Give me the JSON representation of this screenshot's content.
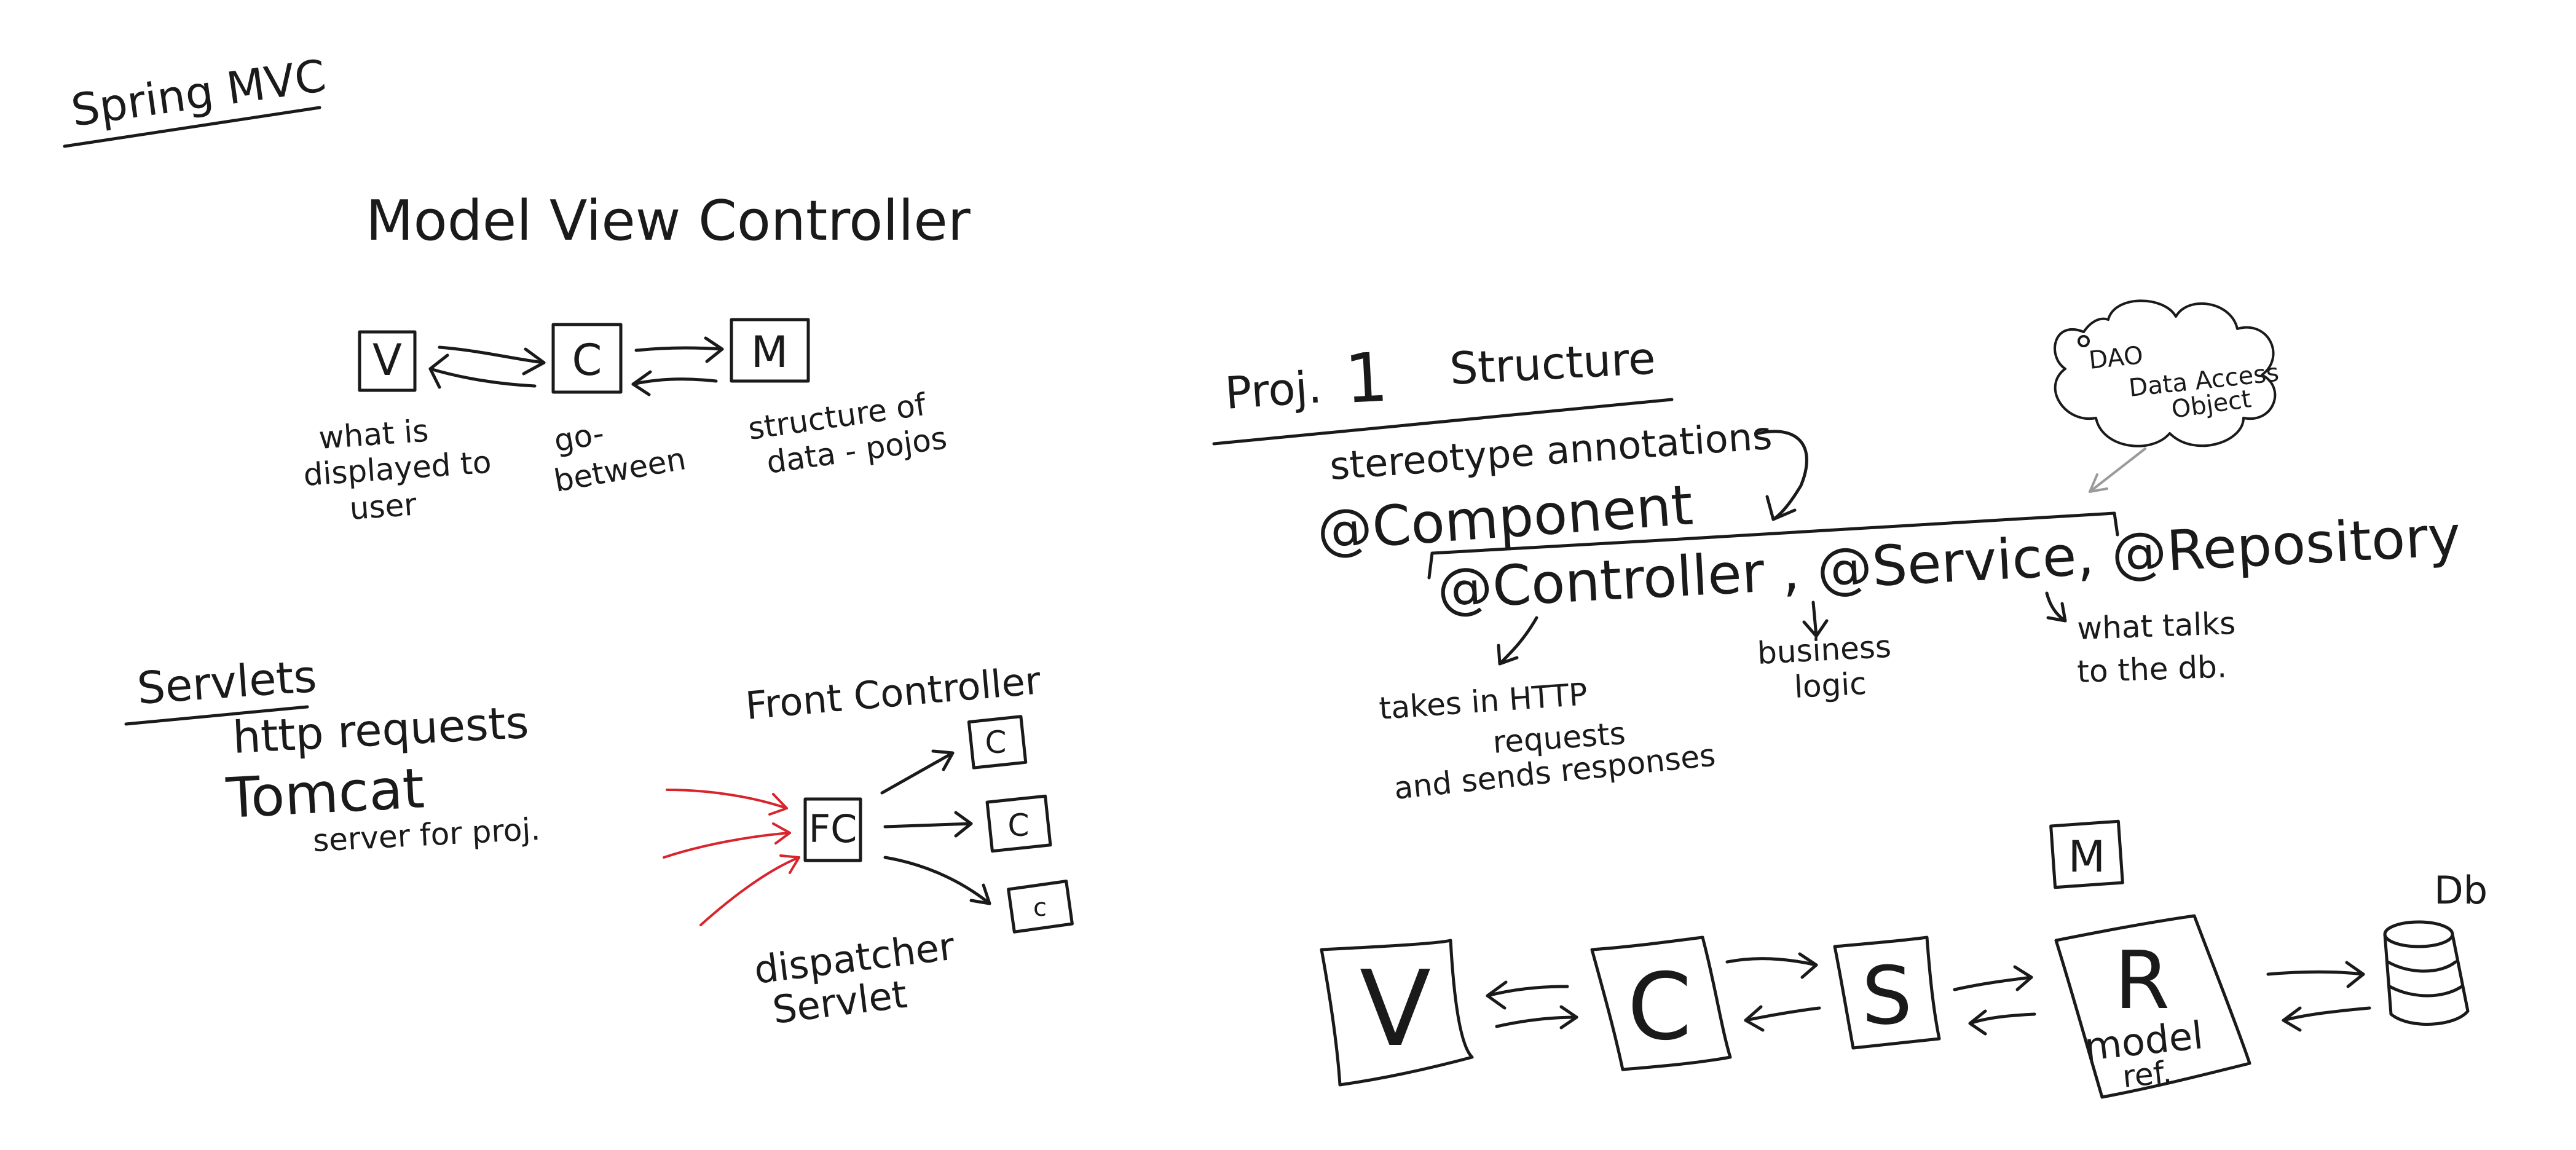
{
  "spring": {
    "title": "Spring MVC"
  },
  "mvc": {
    "title": "Model   View   Controller",
    "boxes": {
      "v": "V",
      "c": "C",
      "m": "M"
    },
    "notes": {
      "v": [
        "what is",
        "displayed to",
        "user"
      ],
      "c": [
        "go-",
        "between"
      ],
      "m": [
        "structure of",
        "data - pojos"
      ]
    }
  },
  "servlets": {
    "title": "Servlets",
    "line1": "http   requests",
    "line2": "Tomcat",
    "line3": "server  for  proj."
  },
  "front_controller": {
    "title": "Front  Controller",
    "fc": "FC",
    "targets": [
      "C",
      "C",
      "c"
    ],
    "caption": [
      "dispatcher",
      "Servlet"
    ]
  },
  "proj": {
    "title_prefix": "Proj.",
    "number": "1",
    "title_suffix": "Structure",
    "stereotype": "stereotype   annotations",
    "component": "@Component",
    "annotations": "@Controller ,  @Service,  @Repository",
    "controller_note": [
      "takes  in  HTTP",
      "requests",
      "and  sends  responses"
    ],
    "service_note": [
      "business",
      "logic"
    ],
    "repository_note": [
      "what  talks",
      "to  the  db."
    ],
    "cloud": [
      "DAO",
      "Data  Access",
      "Object"
    ]
  },
  "architecture": {
    "v": "V",
    "c": "C",
    "s": "S",
    "r": "R",
    "r_note": [
      "model",
      "ref."
    ],
    "m": "M",
    "db_label": "Db"
  }
}
